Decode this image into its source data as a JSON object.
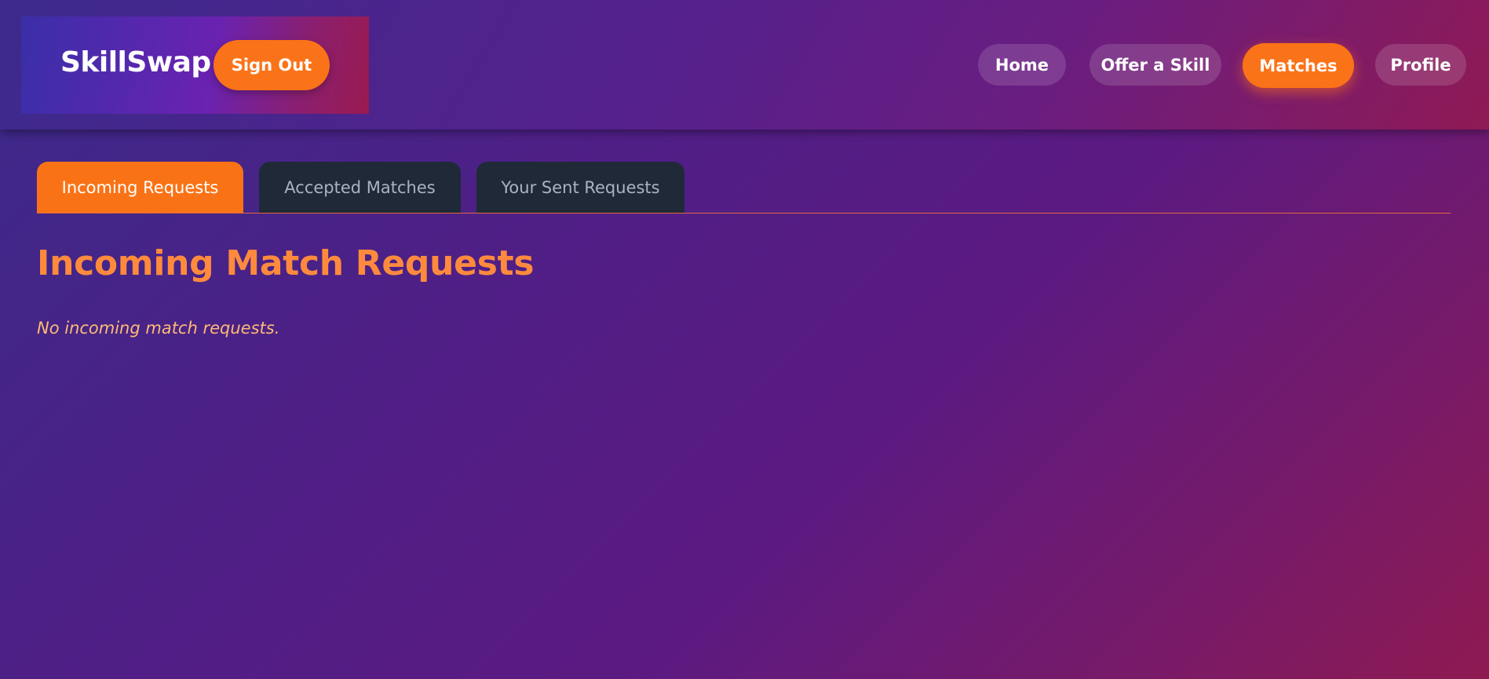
{
  "header": {
    "brand": "SkillSwap",
    "sign_out_label": "Sign Out",
    "nav": [
      {
        "label": "Home",
        "active": false
      },
      {
        "label": "Offer a Skill",
        "active": false
      },
      {
        "label": "Matches",
        "active": true
      },
      {
        "label": "Profile",
        "active": false
      }
    ]
  },
  "tabs": [
    {
      "label": "Incoming Requests",
      "active": true
    },
    {
      "label": "Accepted Matches",
      "active": false
    },
    {
      "label": "Your Sent Requests",
      "active": false
    }
  ],
  "main": {
    "title": "Incoming Match Requests",
    "empty_message": "No incoming match requests."
  },
  "colors": {
    "accent": "#f97316",
    "title": "#ff8a3d",
    "tab_inactive": "#1f2937",
    "empty_text": "#fdba74"
  }
}
